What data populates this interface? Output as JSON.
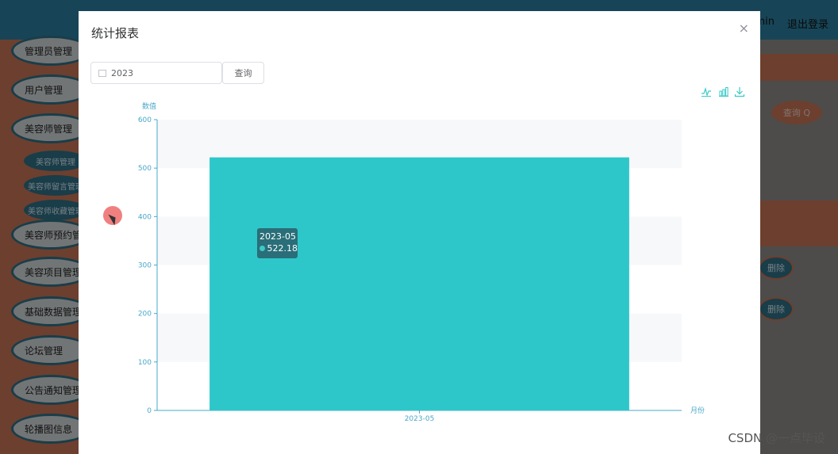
{
  "topbar": {
    "user": "min",
    "logout": "退出登录"
  },
  "sidebar": {
    "items": [
      "管理员管理",
      "用户管理",
      "美容师管理",
      "美容师预约管理",
      "美容项目管理",
      "基础数据管理",
      "论坛管理",
      "公告通知管理",
      "轮播图信息"
    ],
    "subitems": [
      "美容师管理",
      "美容师留言管理",
      "美容师收藏管理"
    ]
  },
  "rightpanel": {
    "search": "查询 Q",
    "delete1": "删除",
    "delete2": "删除"
  },
  "modal": {
    "title": "统计报表",
    "close": "×",
    "date_value": "2023",
    "query_label": "查询"
  },
  "toolbox": {
    "icons": [
      "line-chart-icon",
      "bar-chart-icon",
      "download-icon"
    ],
    "color": "#3cc9c9"
  },
  "chart_data": {
    "type": "bar",
    "categories": [
      "2023-05"
    ],
    "values": [
      522.18
    ],
    "ylabel": "数值",
    "xlabel": "月份",
    "ylim": [
      0,
      600
    ],
    "yticks": [
      0,
      100,
      200,
      300,
      400,
      500,
      600
    ],
    "bar_color": "#2ec7c9",
    "axis_color": "#4aa8c8",
    "tooltip": {
      "category": "2023-05",
      "value": "522.18"
    }
  },
  "watermark": "CSDN @一点毕设"
}
